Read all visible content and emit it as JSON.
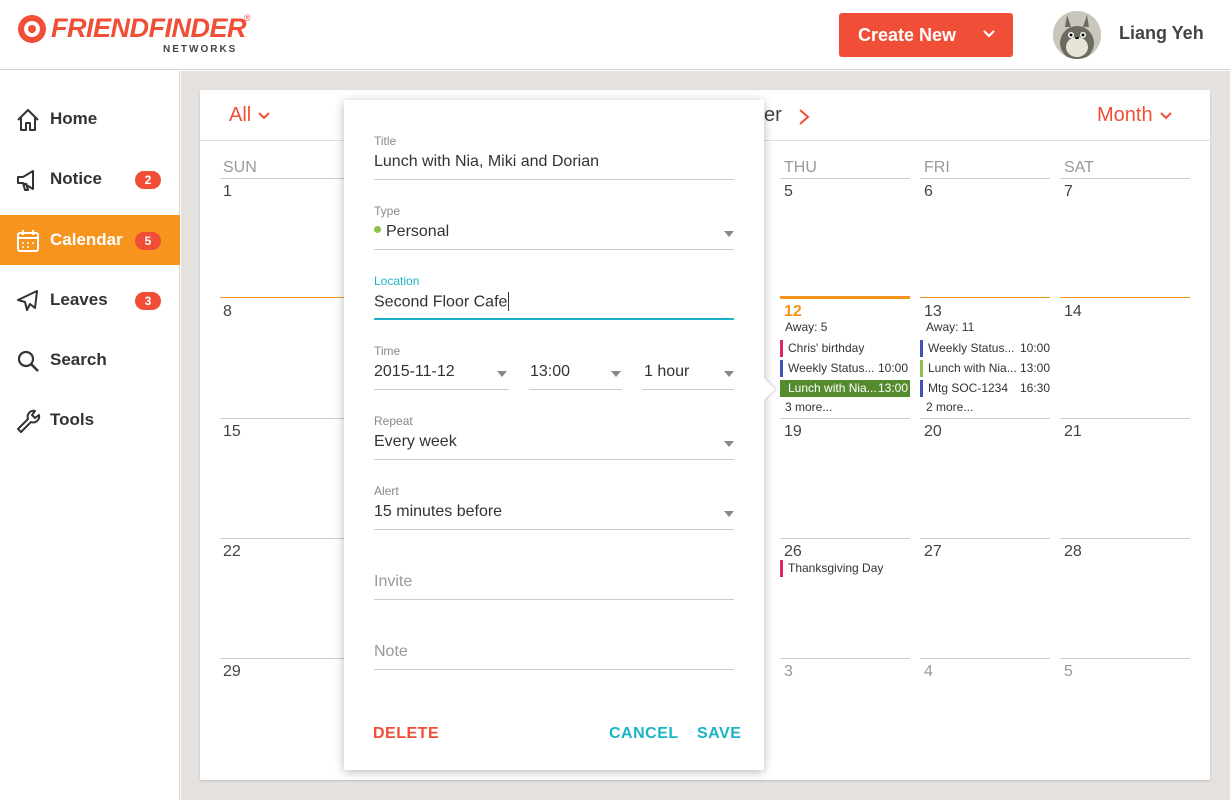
{
  "header": {
    "logo_text": "FRIENDFINDER",
    "logo_reg": "®",
    "logo_sub": "NETWORKS",
    "create_button": "Create New",
    "user_name": "Liang Yeh"
  },
  "sidebar": {
    "items": [
      {
        "label": "Home",
        "icon": "home-icon",
        "badge": ""
      },
      {
        "label": "Notice",
        "icon": "megaphone-icon",
        "badge": "2"
      },
      {
        "label": "Calendar",
        "icon": "calendar-icon",
        "badge": "5",
        "active": true
      },
      {
        "label": "Leaves",
        "icon": "airplane-icon",
        "badge": "3"
      },
      {
        "label": "Search",
        "icon": "search-icon",
        "badge": ""
      },
      {
        "label": "Tools",
        "icon": "wrench-icon",
        "badge": ""
      }
    ]
  },
  "calendar": {
    "filter": "All",
    "title_fragment": "er",
    "view": "Month",
    "days_of_week": [
      "SUN",
      "THU",
      "FRI",
      "SAT"
    ],
    "day_numbers": {
      "sun": [
        "1",
        "8",
        "15",
        "22",
        "29"
      ],
      "thu": [
        "5",
        "12",
        "19",
        "26",
        "3"
      ],
      "fri": [
        "6",
        "13",
        "20",
        "27",
        "4"
      ],
      "sat": [
        "7",
        "14",
        "21",
        "28",
        "5"
      ]
    },
    "thu12": {
      "away": "Away: 5",
      "events": [
        {
          "title": "Chris' birthday",
          "time": ""
        },
        {
          "title": "Weekly Status...",
          "time": "10:00"
        },
        {
          "title": "Lunch with Nia...",
          "time": "13:00"
        }
      ],
      "more": "3 more..."
    },
    "fri13": {
      "away": "Away: 11",
      "events": [
        {
          "title": "Weekly Status...",
          "time": "10:00"
        },
        {
          "title": "Lunch with Nia...",
          "time": "13:00"
        },
        {
          "title": "Mtg SOC-1234",
          "time": "16:30"
        }
      ],
      "more": "2 more..."
    },
    "thu26": {
      "events": [
        {
          "title": "Thanksgiving Day",
          "time": ""
        }
      ]
    }
  },
  "dialog": {
    "title_label": "Title",
    "title_value": "Lunch with Nia, Miki and Dorian",
    "type_label": "Type",
    "type_value": "Personal",
    "location_label": "Location",
    "location_value": "Second Floor Cafe",
    "time_label": "Time",
    "date_value": "2015-11-12",
    "time_value": "13:00",
    "duration_value": "1 hour",
    "repeat_label": "Repeat",
    "repeat_value": "Every week",
    "alert_label": "Alert",
    "alert_value": "15 minutes before",
    "invite_placeholder": "Invite",
    "note_placeholder": "Note",
    "delete": "DELETE",
    "cancel": "CANCEL",
    "save": "SAVE"
  },
  "colors": {
    "brand": "#f04e37",
    "active_nav": "#f7941d",
    "accent": "#1ab3c7"
  }
}
